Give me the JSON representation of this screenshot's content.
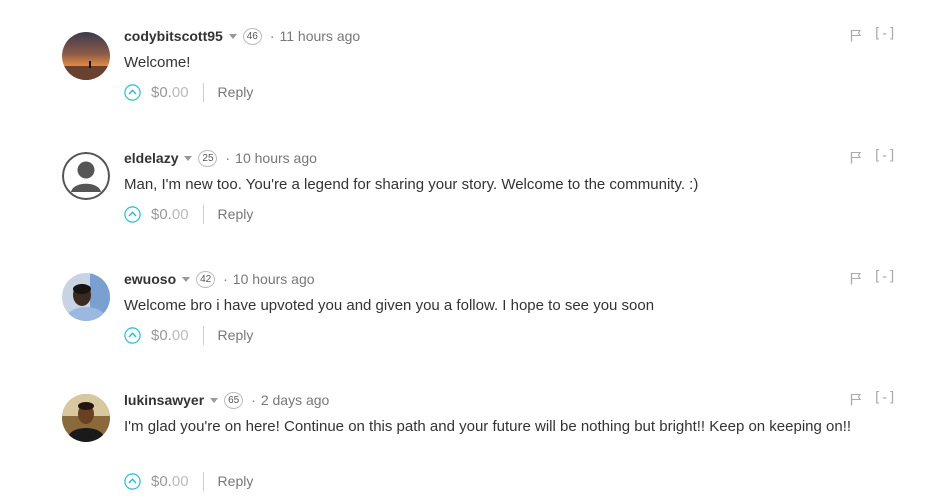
{
  "comments": [
    {
      "author": "codybitscott95",
      "reputation": "46",
      "separator": "·",
      "time": "11 hours ago",
      "body": "Welcome!",
      "payout_main": "$0.",
      "payout_cents": "00",
      "reply_label": "Reply",
      "collapse_label": "[-]"
    },
    {
      "author": "eldelazy",
      "reputation": "25",
      "separator": "·",
      "time": "10 hours ago",
      "body": "Man, I'm new too. You're a legend for sharing your story. Welcome to the community. :)",
      "payout_main": "$0.",
      "payout_cents": "00",
      "reply_label": "Reply",
      "collapse_label": "[-]"
    },
    {
      "author": "ewuoso",
      "reputation": "42",
      "separator": "·",
      "time": "10 hours ago",
      "body": "Welcome bro i have upvoted you and given you a follow. I hope to see you soon",
      "payout_main": "$0.",
      "payout_cents": "00",
      "reply_label": "Reply",
      "collapse_label": "[-]"
    },
    {
      "author": "lukinsawyer",
      "reputation": "65",
      "separator": "·",
      "time": "2 days ago",
      "body": "I'm glad you're on here! Continue on this path and your future will be nothing but bright!! Keep on keeping on!!",
      "payout_main": "$0.",
      "payout_cents": "00",
      "reply_label": "Reply",
      "collapse_label": "[-]"
    }
  ],
  "icons": {
    "upvote": "chevron-up-circle-icon",
    "flag": "flag-icon",
    "dropdown": "caret-down-icon"
  },
  "colors": {
    "upvote_accent": "#1fbfcf",
    "author_text": "#333333",
    "muted_text": "#777777"
  }
}
